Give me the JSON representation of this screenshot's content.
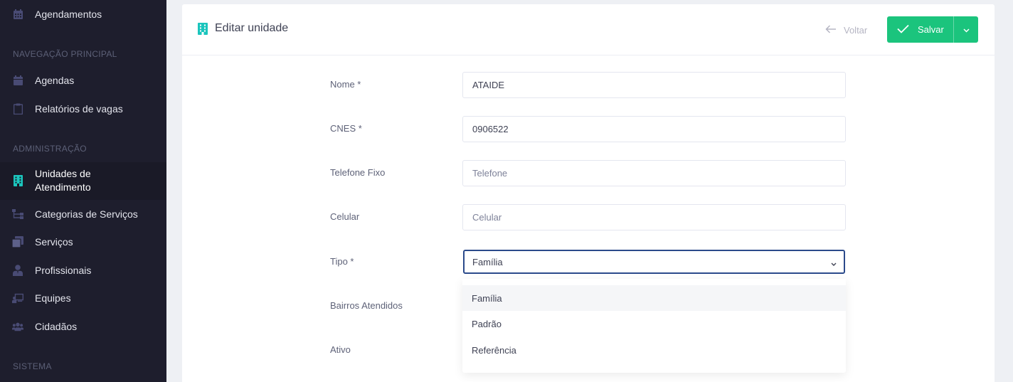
{
  "sidebar": {
    "top_item": {
      "label": "Agendamentos",
      "icon": "calendar-grid-icon"
    },
    "sections": [
      {
        "title": "NAVEGAÇÃO PRINCIPAL"
      },
      {
        "title": "ADMINISTRAÇÃO"
      },
      {
        "title": "SISTEMA"
      }
    ],
    "items": [
      {
        "label": "Agendas",
        "icon": "calendar-icon"
      },
      {
        "label": "Relatórios de vagas",
        "icon": "clipboard-icon"
      },
      {
        "label": "Unidades de Atendimento",
        "line1": "Unidades de",
        "line2": "Atendimento",
        "icon": "building-icon"
      },
      {
        "label": "Categorias de Serviços",
        "icon": "sitemap-icon"
      },
      {
        "label": "Serviços",
        "icon": "layers-icon"
      },
      {
        "label": "Profissionais",
        "icon": "user-tie-icon"
      },
      {
        "label": "Equipes",
        "icon": "chalkboard-user-icon"
      },
      {
        "label": "Cidadãos",
        "icon": "users-icon"
      }
    ],
    "active_color": "#1bc5bd"
  },
  "header": {
    "title": "Editar unidade",
    "back_label": "Voltar",
    "save_label": "Salvar"
  },
  "form": {
    "nome": {
      "label": "Nome *",
      "value": "ATAIDE"
    },
    "cnes": {
      "label": "CNES *",
      "value": "0906522"
    },
    "telefone": {
      "label": "Telefone Fixo",
      "placeholder": "Telefone"
    },
    "celular": {
      "label": "Celular",
      "placeholder": "Celular"
    },
    "tipo": {
      "label": "Tipo *",
      "value": "Família",
      "options": [
        "Família",
        "Padrão",
        "Referência"
      ]
    },
    "bairros": {
      "label": "Bairros Atendidos"
    },
    "ativo": {
      "label": "Ativo"
    }
  },
  "colors": {
    "accent": "#1bc47d",
    "sidebar_bg": "#1e1e2d",
    "focus_border": "#2b4a8b"
  }
}
